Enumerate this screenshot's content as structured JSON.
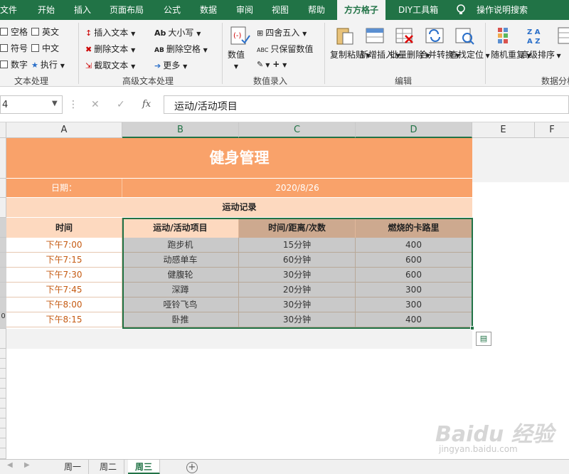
{
  "ribbon_tabs": [
    {
      "label": "文件",
      "active": false
    },
    {
      "label": "开始",
      "active": false
    },
    {
      "label": "插入",
      "active": false
    },
    {
      "label": "页面布局",
      "active": false
    },
    {
      "label": "公式",
      "active": false
    },
    {
      "label": "数据",
      "active": false
    },
    {
      "label": "审阅",
      "active": false
    },
    {
      "label": "视图",
      "active": false
    },
    {
      "label": "帮助",
      "active": false
    },
    {
      "label": "方方格子",
      "active": true
    },
    {
      "label": "DIY工具箱",
      "active": false
    },
    {
      "label": "操作说明搜索",
      "active": false
    }
  ],
  "ribbon": {
    "text_group": {
      "items": [
        "空格",
        "英文",
        "符号",
        "中文",
        "数字",
        "执行"
      ],
      "label": "文本处理"
    },
    "adv_text_group": {
      "items": [
        "插入文本",
        "大小写",
        "删除文本",
        "删除空格",
        "截取文本",
        "更多"
      ],
      "label": "高级文本处理"
    },
    "num_group": {
      "big_button": "数值",
      "items": [
        "四舍五入",
        "只保留数值"
      ],
      "label": "数值录入"
    },
    "edit_group": {
      "buttons": [
        "复制粘贴",
        "新增插入",
        "批量删除",
        "合并转换",
        "查找定位"
      ],
      "label": "编辑"
    },
    "data_group": {
      "buttons": [
        "随机重复",
        "高级排序"
      ],
      "label": "数据分析"
    }
  },
  "formula_bar": {
    "name_box": "4",
    "formula": "运动/活动项目"
  },
  "columns": [
    "A",
    "B",
    "C",
    "D",
    "E",
    "F"
  ],
  "row_numbers": [
    "",
    "",
    "",
    "",
    "",
    "",
    "",
    "",
    "",
    "0"
  ],
  "sheet": {
    "title": "健身管理",
    "date_label": "日期：",
    "date_value": "2020/8/26",
    "record_label": "运动记录",
    "headers": [
      "时间",
      "运动/活动项目",
      "时间/距离/次数",
      "燃烧的卡路里"
    ],
    "rows": [
      [
        "下午7:00",
        "跑步机",
        "15分钟",
        "400"
      ],
      [
        "下午7:15",
        "动感单车",
        "60分钟",
        "600"
      ],
      [
        "下午7:30",
        "健腹轮",
        "30分钟",
        "600"
      ],
      [
        "下午7:45",
        "深蹲",
        "20分钟",
        "300"
      ],
      [
        "下午8:00",
        "哑铃飞鸟",
        "30分钟",
        "300"
      ],
      [
        "下午8:15",
        "卧推",
        "30分钟",
        "400"
      ]
    ]
  },
  "sheet_tabs": [
    {
      "label": "周一",
      "active": false
    },
    {
      "label": "周二",
      "active": false
    },
    {
      "label": "周三",
      "active": true
    }
  ],
  "colors": {
    "excel_green": "#217346",
    "title_orange": "#f9a26a",
    "header_peach": "#fdd9bf",
    "time_text": "#c55a11",
    "selection_gray": "#c9c9c9"
  }
}
